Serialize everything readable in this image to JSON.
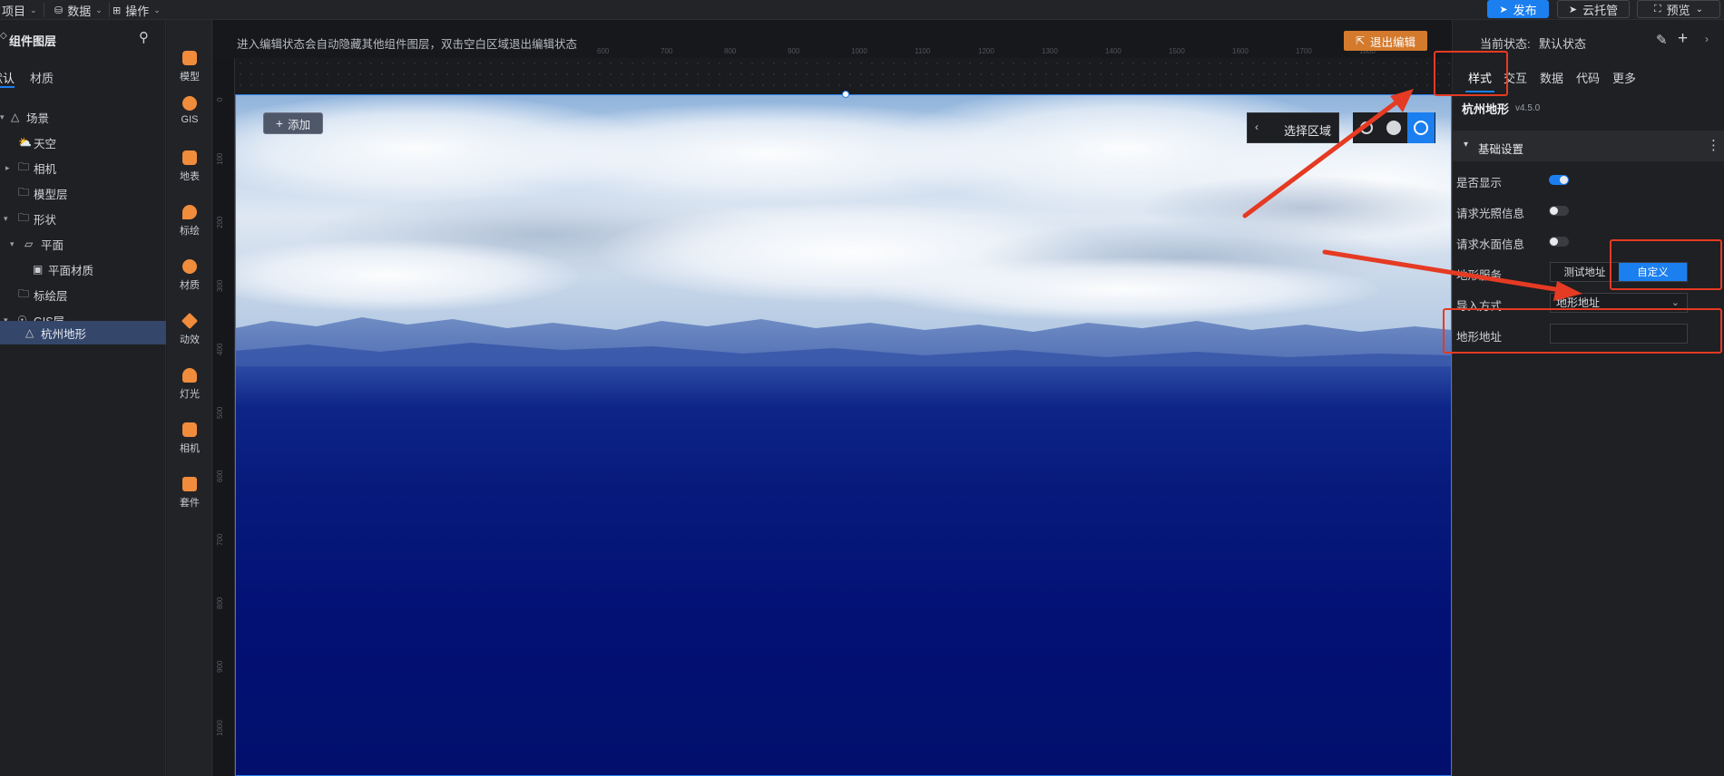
{
  "topbar": {
    "menus": [
      {
        "label": "项目"
      },
      {
        "label": "数据"
      },
      {
        "label": "操作"
      }
    ],
    "publish_label": "发布",
    "cloud_label": "云托管",
    "preview_label": "预览"
  },
  "layers": {
    "title": "组件图层",
    "tabs": [
      "默认",
      "材质"
    ],
    "items": [
      {
        "label": "场景"
      },
      {
        "label": "天空"
      },
      {
        "label": "相机"
      },
      {
        "label": "模型层"
      },
      {
        "label": "形状"
      },
      {
        "label": "平面"
      },
      {
        "label": "平面材质"
      },
      {
        "label": "标绘层"
      },
      {
        "label": "GIS层"
      },
      {
        "label": "杭州地形"
      }
    ]
  },
  "tools": [
    {
      "label": "模型",
      "icon": "model-icon"
    },
    {
      "label": "GIS",
      "icon": "gis-icon"
    },
    {
      "label": "地表",
      "icon": "terrain-icon"
    },
    {
      "label": "标绘",
      "icon": "marker-icon"
    },
    {
      "label": "材质",
      "icon": "material-icon"
    },
    {
      "label": "动效",
      "icon": "effect-icon"
    },
    {
      "label": "灯光",
      "icon": "light-icon"
    },
    {
      "label": "相机",
      "icon": "camera-icon"
    },
    {
      "label": "套件",
      "icon": "kit-icon"
    }
  ],
  "canvas": {
    "hint": "进入编辑状态会自动隐藏其他组件图层，双击空白区域退出编辑状态",
    "exit_edit_label": "退出编辑",
    "add_label": "添加",
    "select_region_label": "选择区域",
    "ruler_top": [
      "600",
      "700",
      "800",
      "900",
      "1000",
      "1100",
      "1200",
      "1300",
      "1400",
      "1500",
      "1600",
      "1700",
      "1800"
    ],
    "ruler_left": [
      "0",
      "100",
      "200",
      "300",
      "400",
      "500",
      "600",
      "700",
      "800",
      "900",
      "1000"
    ]
  },
  "props": {
    "state_label": "当前状态:",
    "state_value": "默认状态",
    "tabs": [
      "样式",
      "交互",
      "数据",
      "代码",
      "更多"
    ],
    "component_name": "杭州地形",
    "component_version": "v4.5.0",
    "section_title": "基础设置",
    "rows": {
      "visible_label": "是否显示",
      "light_label": "请求光照信息",
      "water_label": "请求水面信息",
      "terrain_service_label": "地形服务",
      "terrain_service_options": [
        "测试地址",
        "自定义"
      ],
      "import_label": "导入方式",
      "import_value": "地形地址",
      "address_label": "地形地址",
      "address_value": ""
    }
  },
  "colors": {
    "accent": "#1b7ff0",
    "exit_button": "#d47a2c",
    "annotation": "#e53a23"
  }
}
